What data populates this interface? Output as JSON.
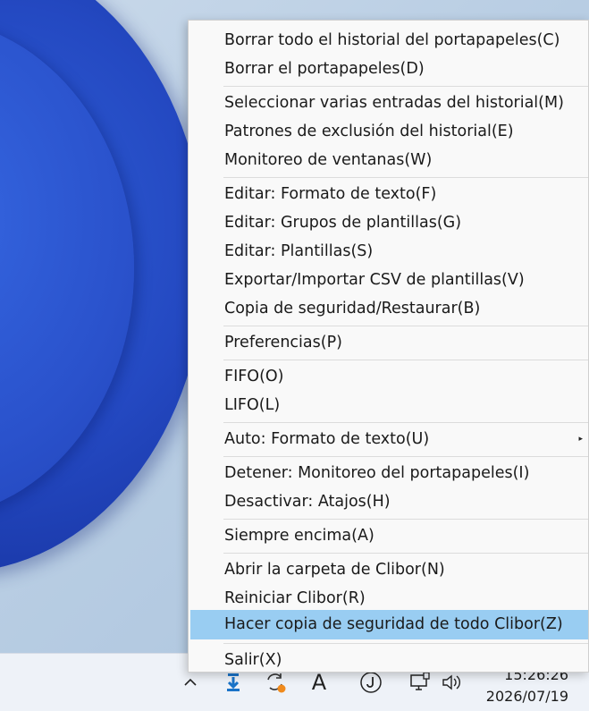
{
  "menu": {
    "items": [
      {
        "label": "Borrar todo el historial del portapapeles(C)"
      },
      {
        "label": "Borrar el portapapeles(D)"
      },
      {
        "label": "Seleccionar varias entradas del historial(M)"
      },
      {
        "label": "Patrones de exclusión del historial(E)"
      },
      {
        "label": "Monitoreo de ventanas(W)"
      },
      {
        "label": "Editar: Formato de texto(F)"
      },
      {
        "label": "Editar: Grupos de plantillas(G)"
      },
      {
        "label": "Editar: Plantillas(S)"
      },
      {
        "label": "Exportar/Importar CSV de plantillas(V)"
      },
      {
        "label": "Copia de seguridad/Restaurar(B)"
      },
      {
        "label": "Preferencias(P)"
      },
      {
        "label": "FIFO(O)"
      },
      {
        "label": "LIFO(L)"
      },
      {
        "label": "Auto: Formato de texto(U)",
        "submenu_arrow": "▸"
      },
      {
        "label": "Detener: Monitoreo del portapapeles(I)"
      },
      {
        "label": "Desactivar: Atajos(H)"
      },
      {
        "label": "Siempre encima(A)"
      },
      {
        "label": "Abrir la carpeta de Clibor(N)"
      },
      {
        "label": "Reiniciar Clibor(R)"
      },
      {
        "label": "Hacer copia de seguridad de todo Clibor(Z)",
        "highlighted": true
      },
      {
        "label": "Salir(X)"
      }
    ]
  },
  "taskbar": {
    "time": "15:26:26",
    "date": "2026/07/19",
    "tray_icons": [
      "chevron-up-icon",
      "clibor-download-icon",
      "sync-icon",
      "ime-a-icon",
      "ime-j-icon",
      "network-icon",
      "volume-icon"
    ],
    "ime_letter": "A",
    "ime_j_letter": "J"
  },
  "colors": {
    "highlight": "#99cdf2",
    "menu_bg": "#f9f9f9",
    "accent_blue": "#2449c2",
    "sync_badge": "#f08a1c"
  }
}
